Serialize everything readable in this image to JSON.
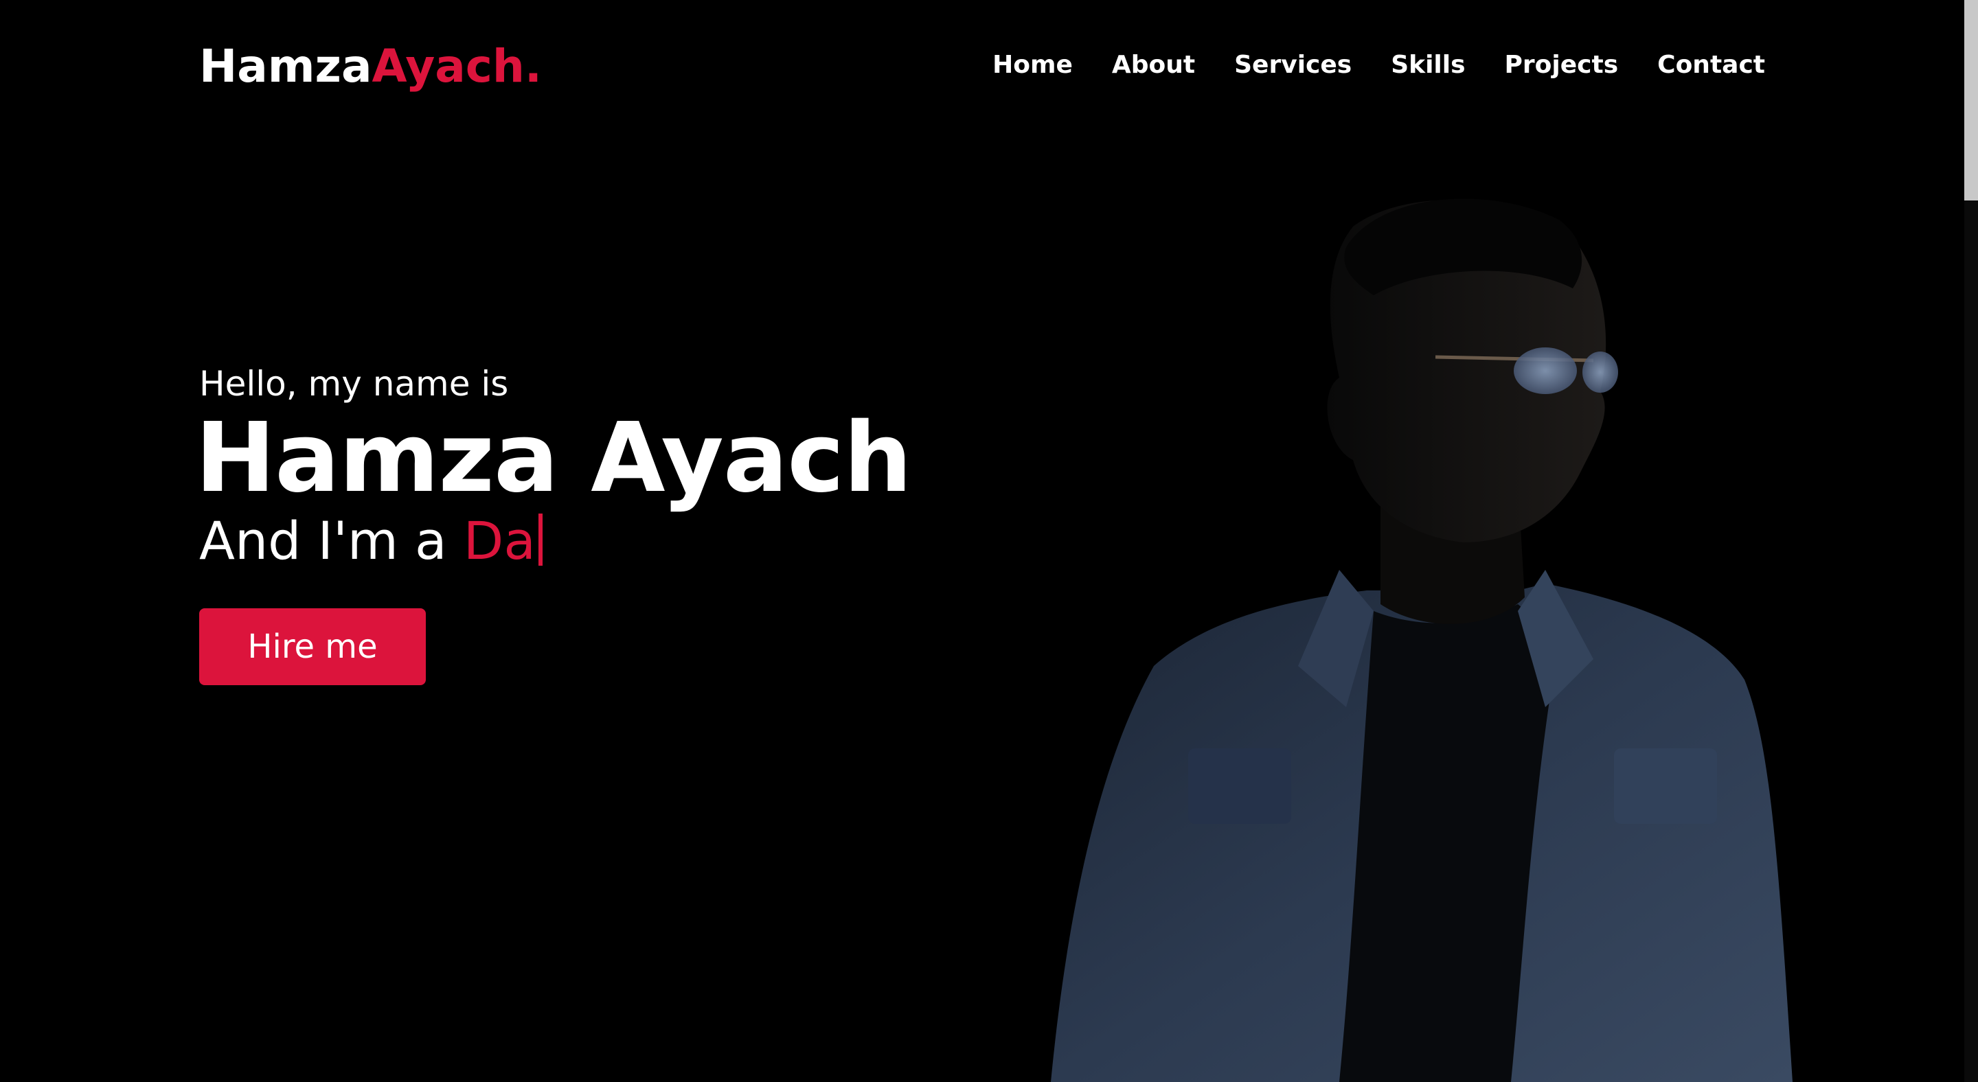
{
  "brand": {
    "first": "Hamza",
    "second": "Ayach."
  },
  "nav": {
    "items": [
      "Home",
      "About",
      "Services",
      "Skills",
      "Projects",
      "Contact"
    ]
  },
  "hero": {
    "greeting": "Hello, my name is",
    "name": "Hamza Ayach",
    "role_prefix": "And I'm a ",
    "role_typed": "Da",
    "button_label": "Hire me"
  },
  "colors": {
    "background": "#000000",
    "accent": "#dc143c",
    "text": "#ffffff"
  }
}
